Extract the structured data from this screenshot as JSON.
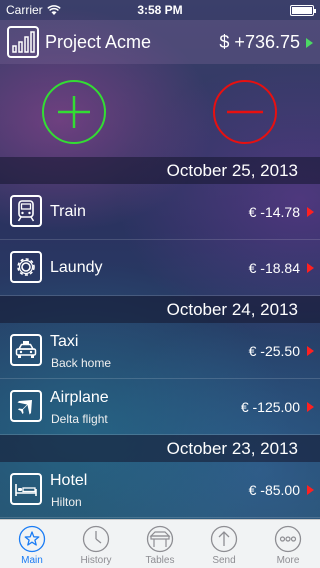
{
  "status": {
    "carrier": "Carrier",
    "time": "3:58 PM"
  },
  "header": {
    "title": "Project Acme",
    "balance": "$ +736.75"
  },
  "groups": [
    {
      "date": "October 25, 2013",
      "items": [
        {
          "name": "Train",
          "sub": "",
          "amount": "€ -14.78",
          "icon": "train-icon"
        },
        {
          "name": "Laundy",
          "sub": "",
          "amount": "€ -18.84",
          "icon": "gear-icon"
        }
      ]
    },
    {
      "date": "October 24, 2013",
      "items": [
        {
          "name": "Taxi",
          "sub": "Back home",
          "amount": "€ -25.50",
          "icon": "taxi-icon"
        },
        {
          "name": "Airplane",
          "sub": "Delta flight",
          "amount": "€ -125.00",
          "icon": "airplane-icon"
        }
      ]
    },
    {
      "date": "October 23, 2013",
      "items": [
        {
          "name": "Hotel",
          "sub": "Hilton",
          "amount": "€ -85.00",
          "icon": "bed-icon"
        }
      ]
    }
  ],
  "tabs": [
    {
      "label": "Main",
      "icon": "star-icon",
      "active": true
    },
    {
      "label": "History",
      "icon": "clock-icon",
      "active": false
    },
    {
      "label": "Tables",
      "icon": "tables-icon",
      "active": false
    },
    {
      "label": "Send",
      "icon": "send-icon",
      "active": false
    },
    {
      "label": "More",
      "icon": "more-icon",
      "active": false
    }
  ],
  "colors": {
    "income": "#33dd33",
    "expense": "#e81010",
    "accent": "#1a7cf5"
  }
}
